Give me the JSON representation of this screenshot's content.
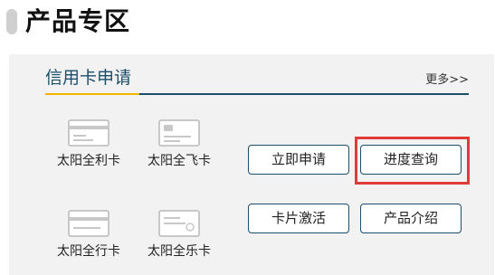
{
  "page": {
    "title": "产品专区"
  },
  "panel": {
    "title": "信用卡申请",
    "more_label": "更多>>"
  },
  "cards": [
    {
      "label": "太阳全利卡",
      "icon": "credit-card-icon"
    },
    {
      "label": "太阳全飞卡",
      "icon": "credit-card-icon"
    },
    {
      "label": "太阳全行卡",
      "icon": "credit-card-icon"
    },
    {
      "label": "太阳全乐卡",
      "icon": "credit-card-icon"
    }
  ],
  "buttons": {
    "apply_now": "立即申请",
    "progress_query": "进度查询",
    "card_activation": "卡片激活",
    "product_intro": "产品介绍"
  },
  "colors": {
    "accent": "#1c4e6a",
    "tab_underline": "#f0b400",
    "highlight": "#e03a3a",
    "panel_background": "#f2f2f2"
  }
}
